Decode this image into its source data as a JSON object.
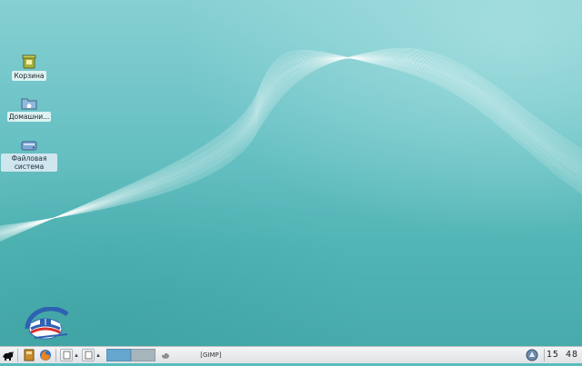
{
  "desktop": {
    "icons": [
      {
        "label": "Корзина",
        "icon": "trash-icon"
      },
      {
        "label": "Домашни...",
        "icon": "home-folder-icon"
      },
      {
        "label": "Файловая система",
        "icon": "drive-icon"
      }
    ],
    "logo_icon": "education-project-logo"
  },
  "taskbar": {
    "launchers": [
      "start-menu-icon",
      "file-manager-icon",
      "firefox-icon"
    ],
    "workspace_switcher": {
      "active": 1,
      "count": 2
    },
    "task": {
      "label": "[GIMP]",
      "icon": "gimp-icon"
    },
    "tray_icon": "network-icon",
    "clock": "15 48"
  },
  "colors": {
    "desktop_bg": "#58bcbd",
    "taskbar_bg": "#e6e9ec",
    "active_workspace": "#65a6cf",
    "inactive_workspace": "#a6b4bc"
  }
}
